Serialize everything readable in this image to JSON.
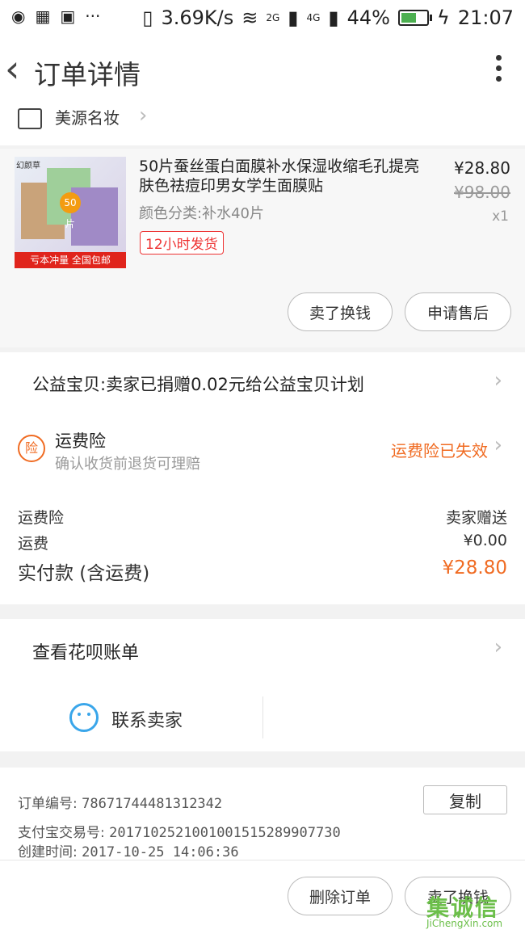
{
  "status_bar": {
    "speed": "3.69K/s",
    "net1": "2G",
    "net2": "4G",
    "battery": "44%",
    "time": "21:07"
  },
  "header": {
    "title": "订单详情"
  },
  "shop": {
    "name": "美源名妆"
  },
  "product": {
    "title": "50片蚕丝蛋白面膜补水保湿收缩毛孔提亮肤色祛痘印男女学生面膜贴",
    "spec": "颜色分类:补水40片",
    "tag": "12小时发货",
    "price": "¥28.80",
    "original_price": "¥98.00",
    "quantity": "x1",
    "image_brand": "幻颜草",
    "image_badge": "50片",
    "image_banner": "亏本冲量 全国包邮",
    "button_sell": "卖了换钱",
    "button_after_sale": "申请售后"
  },
  "charity": {
    "text": "公益宝贝:卖家已捐赠0.02元给公益宝贝计划"
  },
  "shipping_insurance": {
    "icon_char": "险",
    "title": "运费险",
    "subtitle": "确认收货前退货可理赔",
    "status": "运费险已失效"
  },
  "summary": {
    "rows": [
      {
        "label": "运费险",
        "value": "卖家赠送"
      },
      {
        "label": "运费",
        "value": "¥0.00"
      }
    ],
    "paid_label": "实付款 (含运费)",
    "paid_value": "¥28.80"
  },
  "huabei": {
    "text": "查看花呗账单"
  },
  "contact": {
    "label": "联系卖家"
  },
  "order_info": {
    "order_no_label": "订单编号:",
    "order_no": "786717444813123​42",
    "alipay_label": "支付宝交易号:",
    "alipay_no": "2017102521001001515289907730",
    "created_label": "创建时间:",
    "created_time": "2017-10-25 14:06:36",
    "copy_label": "复制"
  },
  "bottom_bar": {
    "delete_label": "删除订单",
    "sell_label": "卖了换钱"
  },
  "watermark": {
    "main": "集诚信",
    "sub": "JiChengXin.com"
  },
  "colors": {
    "accent": "#f06b22",
    "tag_red": "#e33333",
    "contact_blue": "#3aa6ea"
  }
}
